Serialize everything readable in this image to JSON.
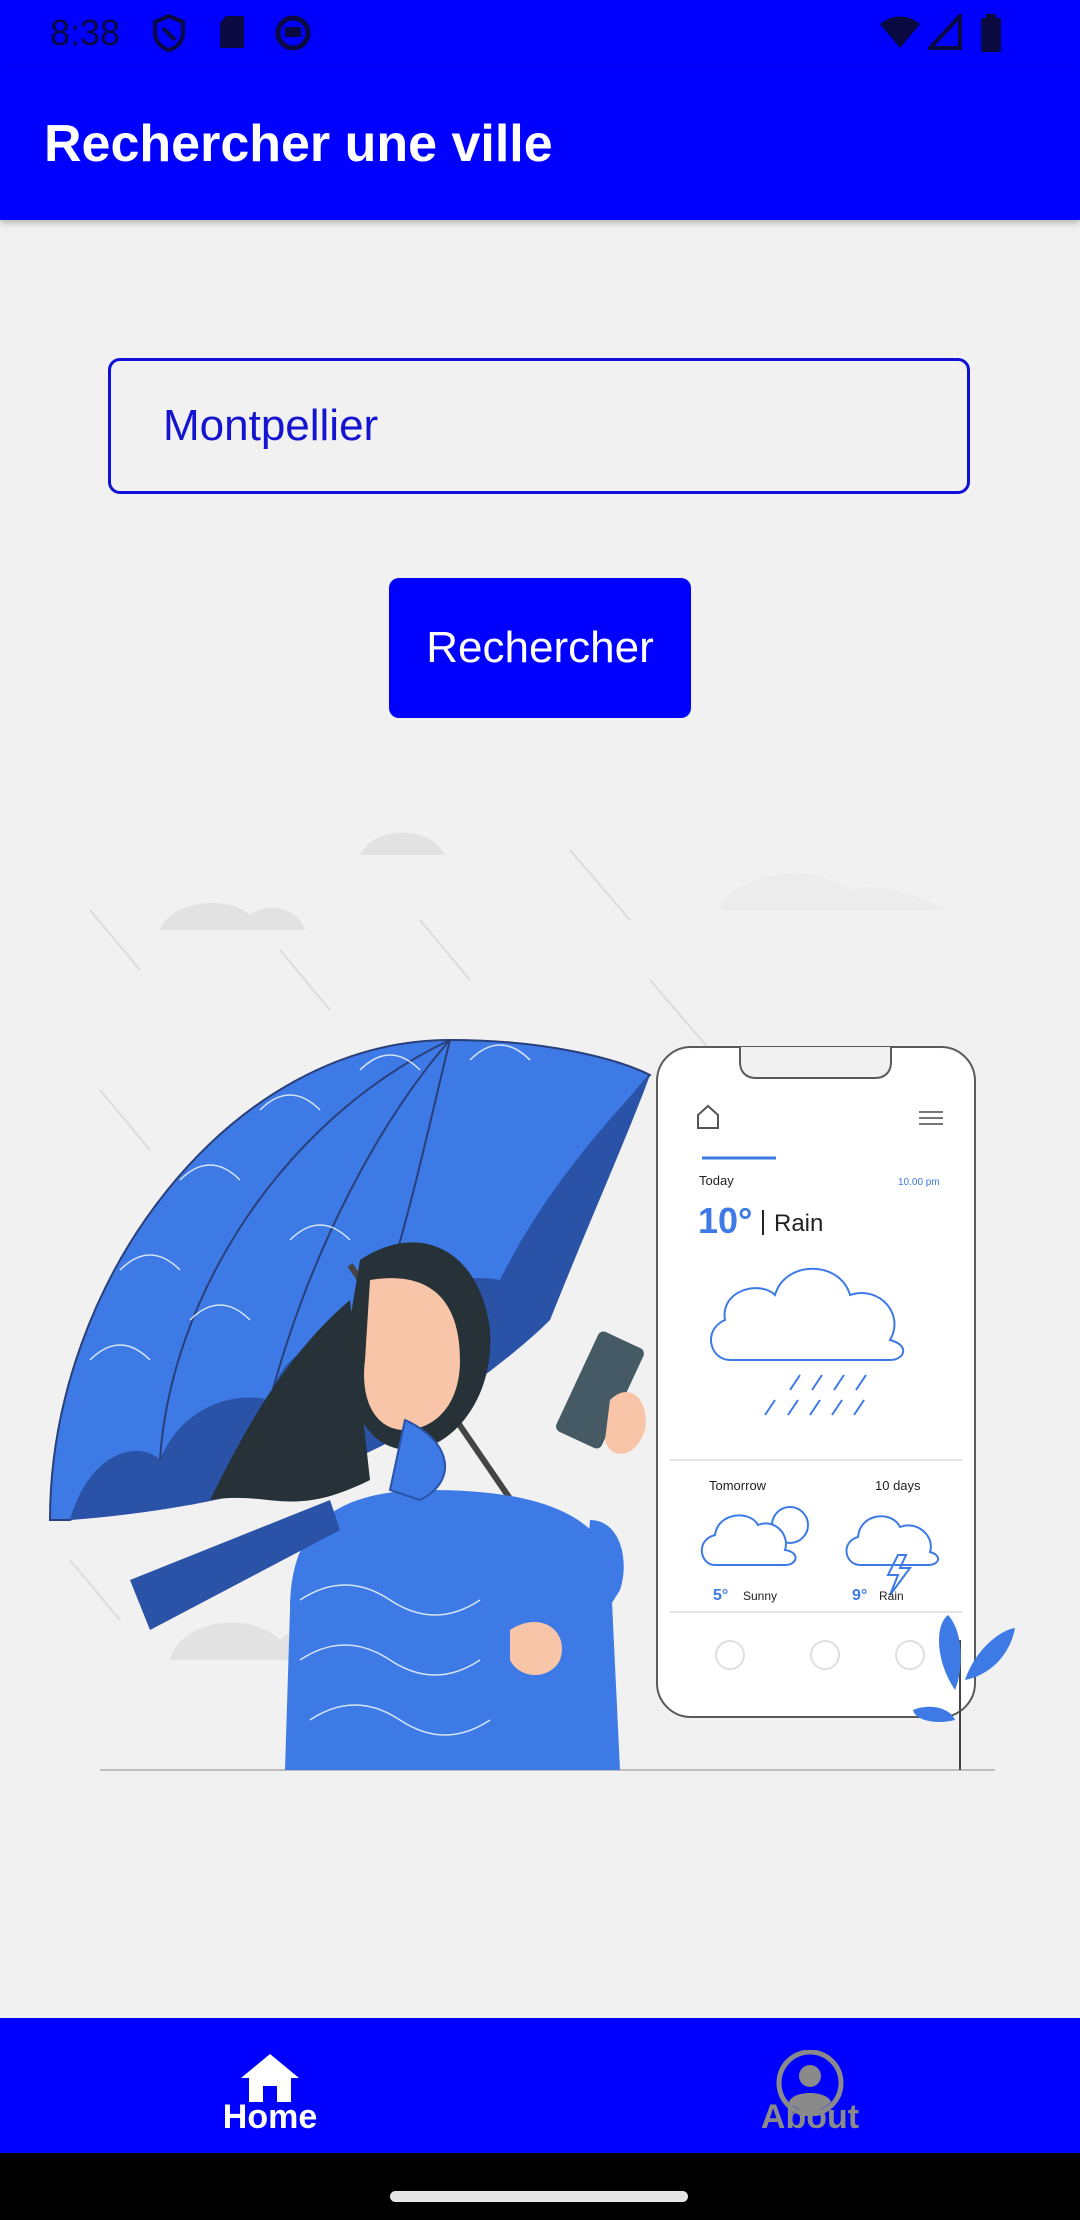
{
  "status_bar": {
    "time": "8:38",
    "icons": [
      "shield-icon",
      "sd-card-icon",
      "circle-status-icon",
      "wifi-icon",
      "signal-icon",
      "battery-icon"
    ]
  },
  "appbar": {
    "title": "Rechercher une ville"
  },
  "search": {
    "value": "Montpellier"
  },
  "actions": {
    "search_label": "Rechercher"
  },
  "illustration": {
    "today": "Today",
    "time": "10.00 pm",
    "temp_today": "10°",
    "cond_today": "Rain",
    "tomorrow": "Tomorrow",
    "ten_days": "10 days",
    "temp_tomorrow": "5°",
    "cond_tomorrow": "Sunny",
    "temp_ten": "9°",
    "cond_ten": "Rain"
  },
  "bottom_nav": {
    "items": [
      {
        "label": "Home",
        "icon": "home-icon",
        "active": true
      },
      {
        "label": "About",
        "icon": "account-icon",
        "active": false
      }
    ]
  },
  "colors": {
    "primary": "#0000ff",
    "background": "#f1f1f1",
    "accent": "#3d7ae5"
  }
}
